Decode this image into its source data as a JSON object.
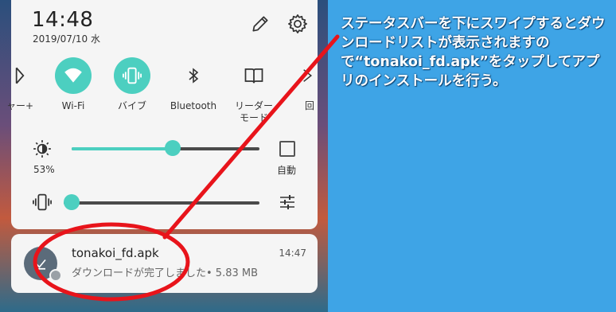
{
  "status": {
    "time": "14:48",
    "date": "2019/07/10 水"
  },
  "quick_settings": [
    {
      "label": "ャー+",
      "icon": "hotspot-icon",
      "active": false
    },
    {
      "label": "Wi-Fi",
      "icon": "wifi-icon",
      "active": true
    },
    {
      "label": "バイブ",
      "icon": "vibrate-icon",
      "active": true
    },
    {
      "label": "Bluetooth",
      "icon": "bluetooth-icon",
      "active": false
    },
    {
      "label": "リーダー\nモード",
      "icon": "book-icon",
      "active": false
    },
    {
      "label": "回",
      "icon": "rotate-icon",
      "active": false
    }
  ],
  "brightness": {
    "percent_label": "53%",
    "level": 0.54,
    "auto_label": "自動"
  },
  "volume": {
    "level": 0.0
  },
  "notification": {
    "title": "tonakoi_fd.apk",
    "subtitle": "ダウンロードが完了しました• 5.83 MB",
    "time": "14:47"
  },
  "caption": "ステータスバーを下にスワイプするとダウンロードリストが表示されますので“tonakoi_fd.apk”をタップしてアプリのインストールを行う。",
  "colors": {
    "accent": "#4ccfc0",
    "background": "#3ea4e6",
    "annotation": "#e8141b"
  }
}
